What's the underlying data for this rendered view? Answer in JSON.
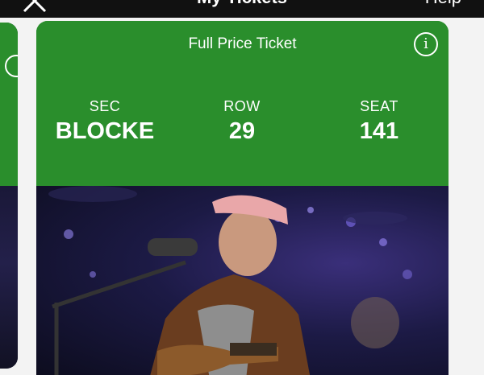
{
  "topbar": {
    "title": "My Tickets",
    "help_label": "Help"
  },
  "ticket": {
    "type_label": "Full Price Ticket",
    "section_label": "SEC",
    "section_value": "BLOCKE",
    "row_label": "ROW",
    "row_value": "29",
    "seat_label": "SEAT",
    "seat_value": "141"
  },
  "colors": {
    "ticket_green": "#2a8e2c",
    "topbar": "#111111"
  },
  "icons": {
    "close": "close-icon",
    "info": "info-icon"
  }
}
